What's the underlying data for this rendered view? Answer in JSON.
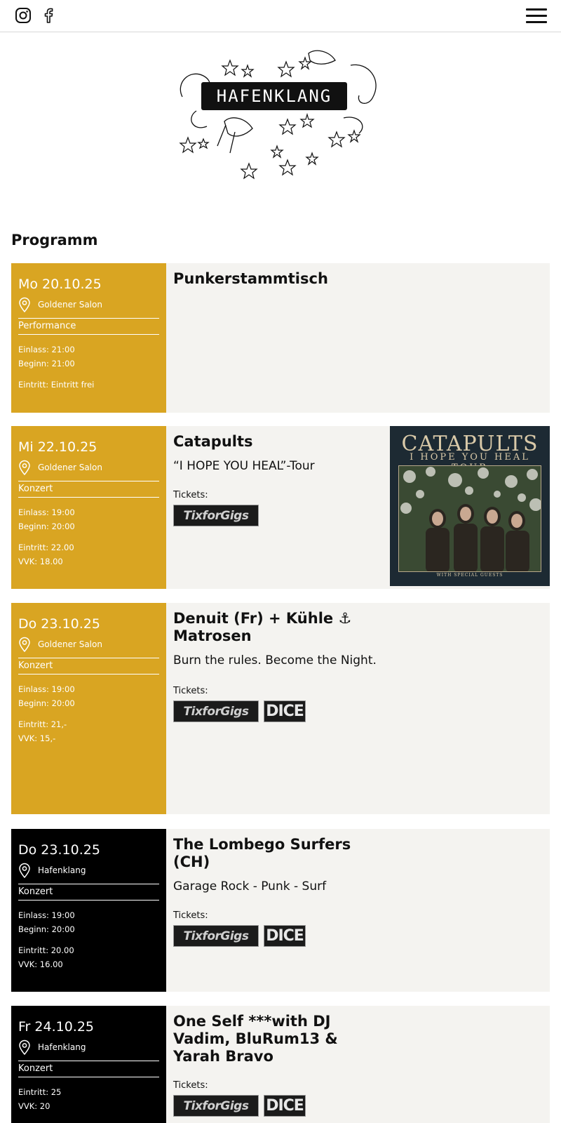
{
  "header": {
    "social": [
      {
        "icon": "instagram-icon"
      },
      {
        "icon": "facebook-icon"
      }
    ],
    "menu_icon": "hamburger-menu-icon"
  },
  "logo": {
    "text": "HAFENKLANG"
  },
  "page_title": "Programm",
  "colors": {
    "gold": "#d9a522",
    "black": "#000000",
    "card_bg": "#f4f3f0"
  },
  "events": [
    {
      "date": "Mo 20.10.25",
      "venue": "Goldener Salon",
      "category": "Performance",
      "einlass": "Einlass: 21:00",
      "beginn": "Beginn: 21:00",
      "entry": [
        "Eintritt: Eintritt frei"
      ],
      "title": "Punkerstammtisch",
      "subtitle": "",
      "tickets_label": "",
      "tickets": [],
      "theme": "gold"
    },
    {
      "date": "Mi 22.10.25",
      "venue": "Goldener Salon",
      "category": "Konzert",
      "einlass": "Einlass: 19:00",
      "beginn": "Beginn: 20:00",
      "entry": [
        "Eintritt: 22.00",
        "VVK: 18.00"
      ],
      "title": "Catapults",
      "subtitle": "“I HOPE YOU HEAL”-Tour",
      "tickets_label": "Tickets:",
      "tickets": [
        "TixforGigs"
      ],
      "poster": {
        "title": "CATAPULTS",
        "subtitle": "I HOPE YOU HEAL TOUR",
        "footer": "WITH SPECIAL GUESTS"
      },
      "theme": "gold"
    },
    {
      "date": "Do 23.10.25",
      "venue": "Goldener Salon",
      "category": "Konzert",
      "einlass": "Einlass: 19:00",
      "beginn": "Beginn: 20:00",
      "entry": [
        "Eintritt: 21,-",
        "VVK: 15,-"
      ],
      "title": "Denuit (Fr) + Kühle ⚓ Matrosen",
      "subtitle": "Burn the rules. Become the Night.",
      "tickets_label": "Tickets:",
      "tickets": [
        "TixforGigs",
        "DICE"
      ],
      "theme": "gold"
    },
    {
      "date": "Do 23.10.25",
      "venue": "Hafenklang",
      "category": "Konzert",
      "einlass": "Einlass: 19:00",
      "beginn": "Beginn: 20:00",
      "entry": [
        "Eintritt: 20.00",
        "VVK: 16.00"
      ],
      "title": "The Lombego Surfers (CH)",
      "subtitle": "Garage Rock - Punk - Surf",
      "tickets_label": "Tickets:",
      "tickets": [
        "TixforGigs",
        "DICE"
      ],
      "theme": "black"
    },
    {
      "date": "Fr 24.10.25",
      "venue": "Hafenklang",
      "category": "Konzert",
      "einlass": "",
      "beginn": "",
      "entry": [
        "Eintritt: 25",
        "VVK: 20"
      ],
      "title": "One Self ***with DJ Vadim, BluRum13 & Yarah Bravo",
      "subtitle": "",
      "tickets_label": "Tickets:",
      "tickets": [
        "TixforGigs",
        "DICE"
      ],
      "theme": "black"
    }
  ]
}
